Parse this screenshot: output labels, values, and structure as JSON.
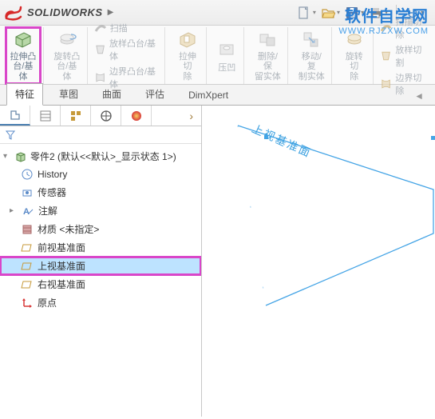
{
  "app": {
    "title": "SOLIDWORKS"
  },
  "watermark": {
    "line1": "软件自学网",
    "line2": "WWW.RJZXW.COM"
  },
  "ribbon": {
    "extrude_boss": "拉伸凸\n台/基体",
    "revolve_boss": "旋转凸\n台/基体",
    "sweep": "扫描",
    "loft": "放样凸台/基体",
    "boundary": "边界凸台/基体",
    "extrude_cut": "拉伸切\n除",
    "hole": "压凹",
    "delete_keep": "删除/保\n留实体",
    "move_copy": "移动/复\n制实体",
    "revolve_cut": "旋转切\n除",
    "sweep_cut": "扫描切除",
    "loft_cut": "放样切割",
    "boundary_cut": "边界切除"
  },
  "tabs": {
    "feature": "特征",
    "sketch": "草图",
    "surface": "曲面",
    "evaluate": "评估",
    "dimxpert": "DimXpert"
  },
  "tree": {
    "root": "零件2 (默认<<默认>_显示状态 1>)",
    "history": "History",
    "sensors": "传感器",
    "annotations": "注解",
    "material": "材质 <未指定>",
    "front_plane": "前视基准面",
    "top_plane": "上视基准面",
    "right_plane": "右视基准面",
    "origin": "原点"
  },
  "canvas": {
    "plane_label": "上视基准面"
  }
}
